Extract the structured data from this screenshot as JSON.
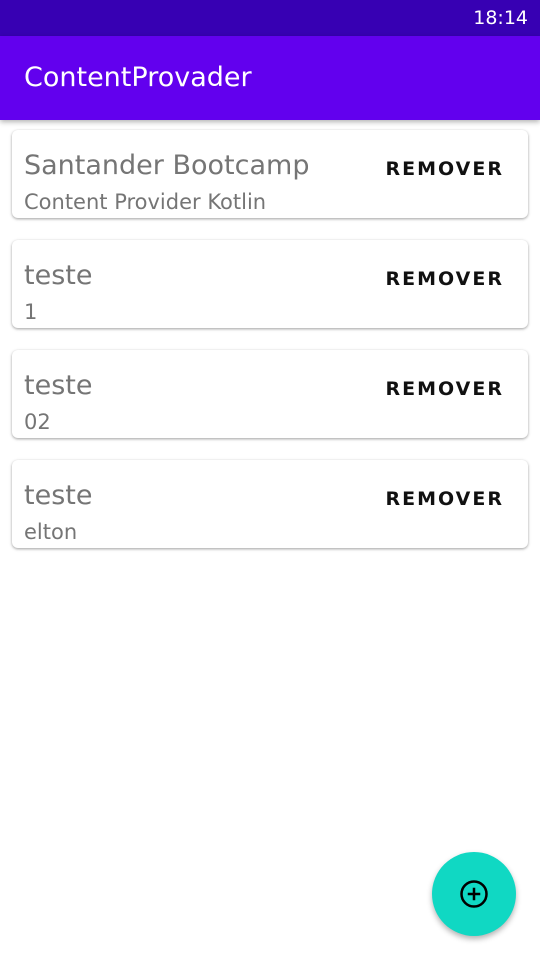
{
  "status_bar": {
    "time": "18:14"
  },
  "app_bar": {
    "title": "ContentProvader"
  },
  "notes": [
    {
      "title": "Santander Bootcamp",
      "description": "Content Provider Kotlin",
      "remove_label": "REMOVER"
    },
    {
      "title": "teste",
      "description": "1",
      "remove_label": "REMOVER"
    },
    {
      "title": "teste",
      "description": "02",
      "remove_label": "REMOVER"
    },
    {
      "title": "teste",
      "description": "elton",
      "remove_label": "REMOVER"
    }
  ],
  "fab": {
    "icon": "add-circle-icon"
  },
  "colors": {
    "status_bar": "#3700b3",
    "primary": "#6200ee",
    "fab": "#10d8c3",
    "text_secondary": "#757575"
  }
}
